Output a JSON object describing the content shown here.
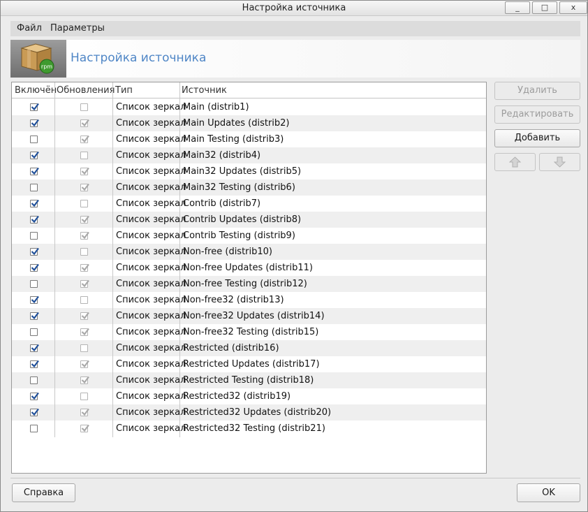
{
  "window": {
    "title": "Настройка источника",
    "controls": {
      "minimize": "_",
      "maximize": "□",
      "close": "x"
    }
  },
  "menu": [
    "Файл",
    "Параметры"
  ],
  "banner": {
    "title": "Настройка источника",
    "icon": "rpm-package-icon"
  },
  "table": {
    "headers": [
      "Включён",
      "Обновления",
      "Тип",
      "Источник"
    ],
    "rows": [
      {
        "enabled": true,
        "updates": false,
        "type": "Список зеркал",
        "source": "Main (distrib1)"
      },
      {
        "enabled": true,
        "updates": true,
        "type": "Список зеркал",
        "source": "Main Updates (distrib2)"
      },
      {
        "enabled": false,
        "updates": true,
        "type": "Список зеркал",
        "source": "Main Testing (distrib3)"
      },
      {
        "enabled": true,
        "updates": false,
        "type": "Список зеркал",
        "source": "Main32 (distrib4)"
      },
      {
        "enabled": true,
        "updates": true,
        "type": "Список зеркал",
        "source": "Main32 Updates (distrib5)"
      },
      {
        "enabled": false,
        "updates": true,
        "type": "Список зеркал",
        "source": "Main32 Testing (distrib6)"
      },
      {
        "enabled": true,
        "updates": false,
        "type": "Список зеркал",
        "source": "Contrib (distrib7)"
      },
      {
        "enabled": true,
        "updates": true,
        "type": "Список зеркал",
        "source": "Contrib Updates (distrib8)"
      },
      {
        "enabled": false,
        "updates": true,
        "type": "Список зеркал",
        "source": "Contrib Testing (distrib9)"
      },
      {
        "enabled": true,
        "updates": false,
        "type": "Список зеркал",
        "source": "Non-free (distrib10)"
      },
      {
        "enabled": true,
        "updates": true,
        "type": "Список зеркал",
        "source": "Non-free Updates (distrib11)"
      },
      {
        "enabled": false,
        "updates": true,
        "type": "Список зеркал",
        "source": "Non-free Testing (distrib12)"
      },
      {
        "enabled": true,
        "updates": false,
        "type": "Список зеркал",
        "source": "Non-free32 (distrib13)"
      },
      {
        "enabled": true,
        "updates": true,
        "type": "Список зеркал",
        "source": "Non-free32 Updates (distrib14)"
      },
      {
        "enabled": false,
        "updates": true,
        "type": "Список зеркал",
        "source": "Non-free32 Testing (distrib15)"
      },
      {
        "enabled": true,
        "updates": false,
        "type": "Список зеркал",
        "source": "Restricted (distrib16)"
      },
      {
        "enabled": true,
        "updates": true,
        "type": "Список зеркал",
        "source": "Restricted Updates (distrib17)"
      },
      {
        "enabled": false,
        "updates": true,
        "type": "Список зеркал",
        "source": "Restricted Testing (distrib18)"
      },
      {
        "enabled": true,
        "updates": false,
        "type": "Список зеркал",
        "source": "Restricted32 (distrib19)"
      },
      {
        "enabled": true,
        "updates": true,
        "type": "Список зеркал",
        "source": "Restricted32 Updates (distrib20)"
      },
      {
        "enabled": false,
        "updates": true,
        "type": "Список зеркал",
        "source": "Restricted32 Testing (distrib21)"
      }
    ]
  },
  "side_buttons": {
    "remove": "Удалить",
    "edit": "Редактировать",
    "add": "Добавить",
    "move_up_icon": "arrow-up-icon",
    "move_down_icon": "arrow-down-icon"
  },
  "footer": {
    "help": "Справка",
    "ok": "OK"
  },
  "colors": {
    "accent": "#4f86c6",
    "check": "#1f4f99"
  }
}
